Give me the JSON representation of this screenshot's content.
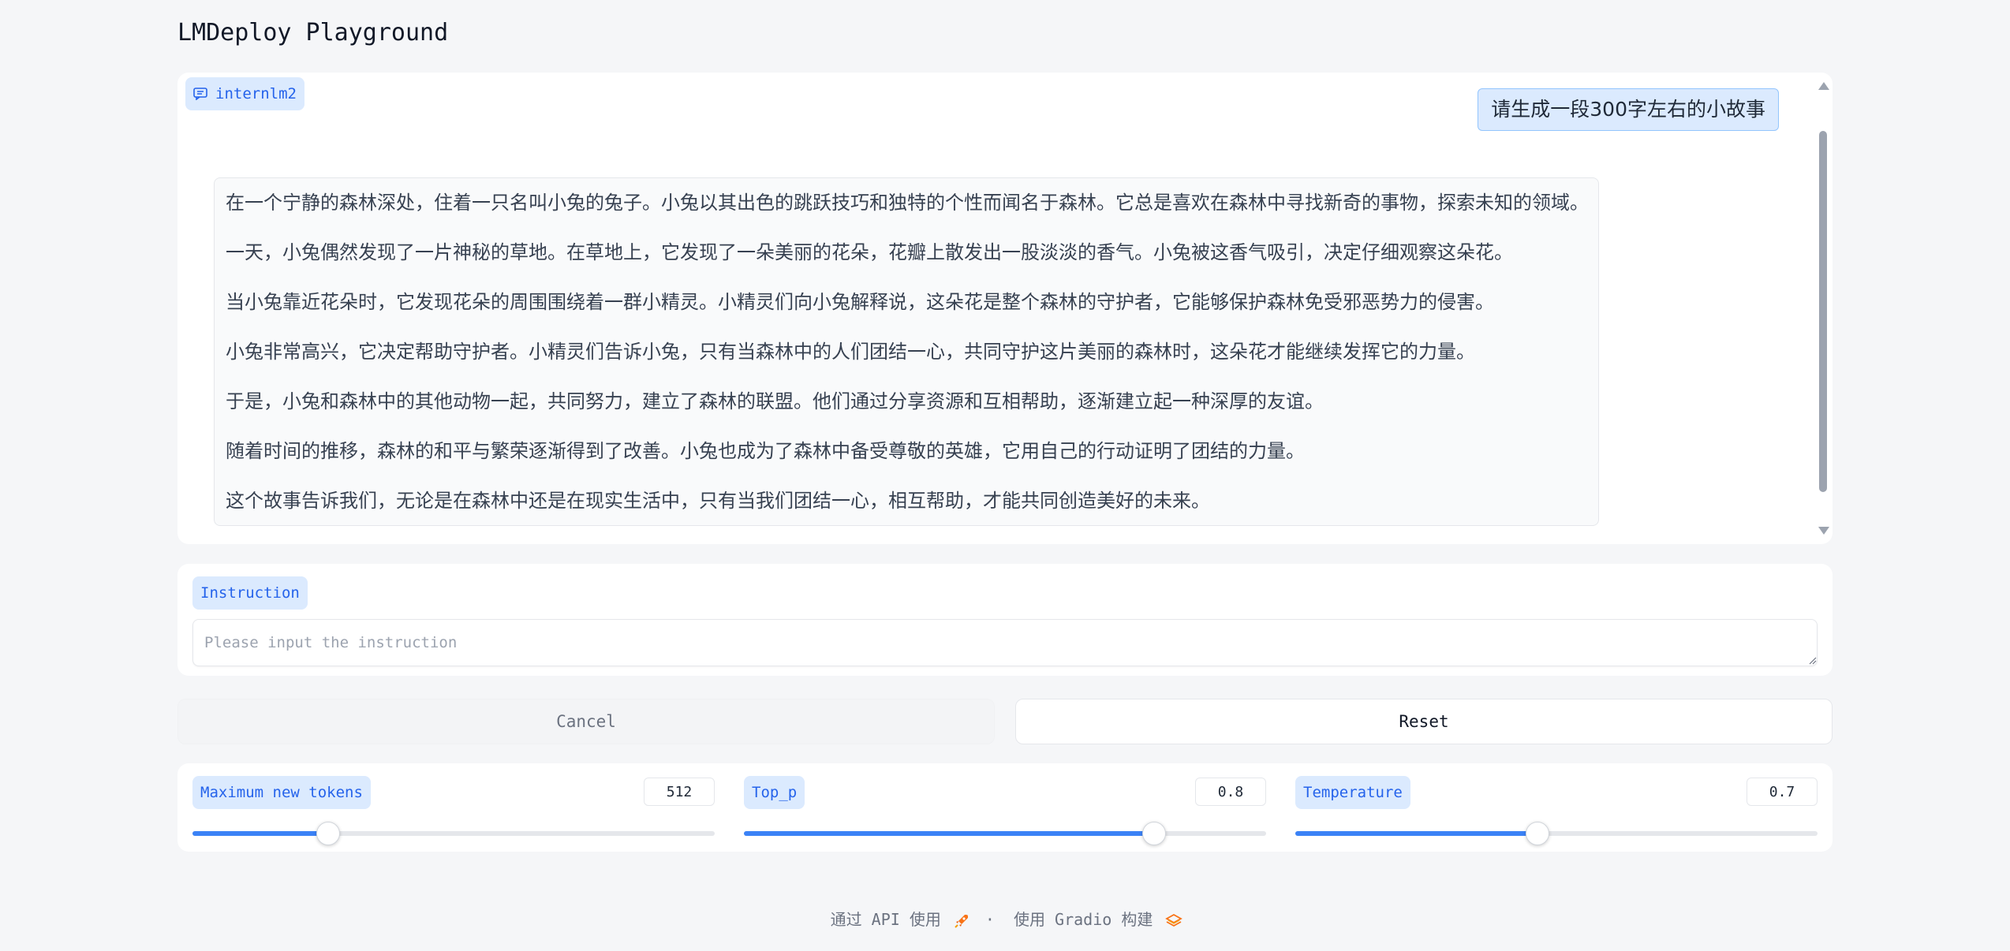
{
  "app": {
    "title": "LMDeploy Playground"
  },
  "chatbot": {
    "label": "internlm2",
    "icon": "chat-bubble-icon",
    "user_message": "请生成一段300字左右的小故事",
    "assistant_message": [
      "在一个宁静的森林深处，住着一只名叫小兔的兔子。小兔以其出色的跳跃技巧和独特的个性而闻名于森林。它总是喜欢在森林中寻找新奇的事物，探索未知的领域。",
      "一天，小兔偶然发现了一片神秘的草地。在草地上，它发现了一朵美丽的花朵，花瓣上散发出一股淡淡的香气。小兔被这香气吸引，决定仔细观察这朵花。",
      "当小兔靠近花朵时，它发现花朵的周围围绕着一群小精灵。小精灵们向小兔解释说，这朵花是整个森林的守护者，它能够保护森林免受邪恶势力的侵害。",
      "小兔非常高兴，它决定帮助守护者。小精灵们告诉小兔，只有当森林中的人们团结一心，共同守护这片美丽的森林时，这朵花才能继续发挥它的力量。",
      "于是，小兔和森林中的其他动物一起，共同努力，建立了森林的联盟。他们通过分享资源和互相帮助，逐渐建立起一种深厚的友谊。",
      "随着时间的推移，森林的和平与繁荣逐渐得到了改善。小兔也成为了森林中备受尊敬的英雄，它用自己的行动证明了团结的力量。",
      "这个故事告诉我们，无论是在森林中还是在现实生活中，只有当我们团结一心，相互帮助，才能共同创造美好的未来。"
    ],
    "scroll_fraction": 0.0
  },
  "instruction": {
    "label": "Instruction",
    "value": "",
    "placeholder": "Please input the instruction"
  },
  "buttons": {
    "cancel": "Cancel",
    "reset": "Reset"
  },
  "params": [
    {
      "label": "Maximum new tokens",
      "value": "512",
      "fraction": 0.26
    },
    {
      "label": "Top_p",
      "value": "0.8",
      "fraction": 0.785
    },
    {
      "label": "Temperature",
      "value": "0.7",
      "fraction": 0.463
    }
  ],
  "footer": {
    "api_text": "通过 API 使用",
    "api_icon": "rocket-icon",
    "separator": "·",
    "built_text": "使用 Gradio 构建",
    "built_icon": "gradio-logo-icon"
  },
  "colors": {
    "accent": "#3b82f6",
    "chip_bg": "#dbeafe",
    "chip_text": "#2563eb"
  }
}
